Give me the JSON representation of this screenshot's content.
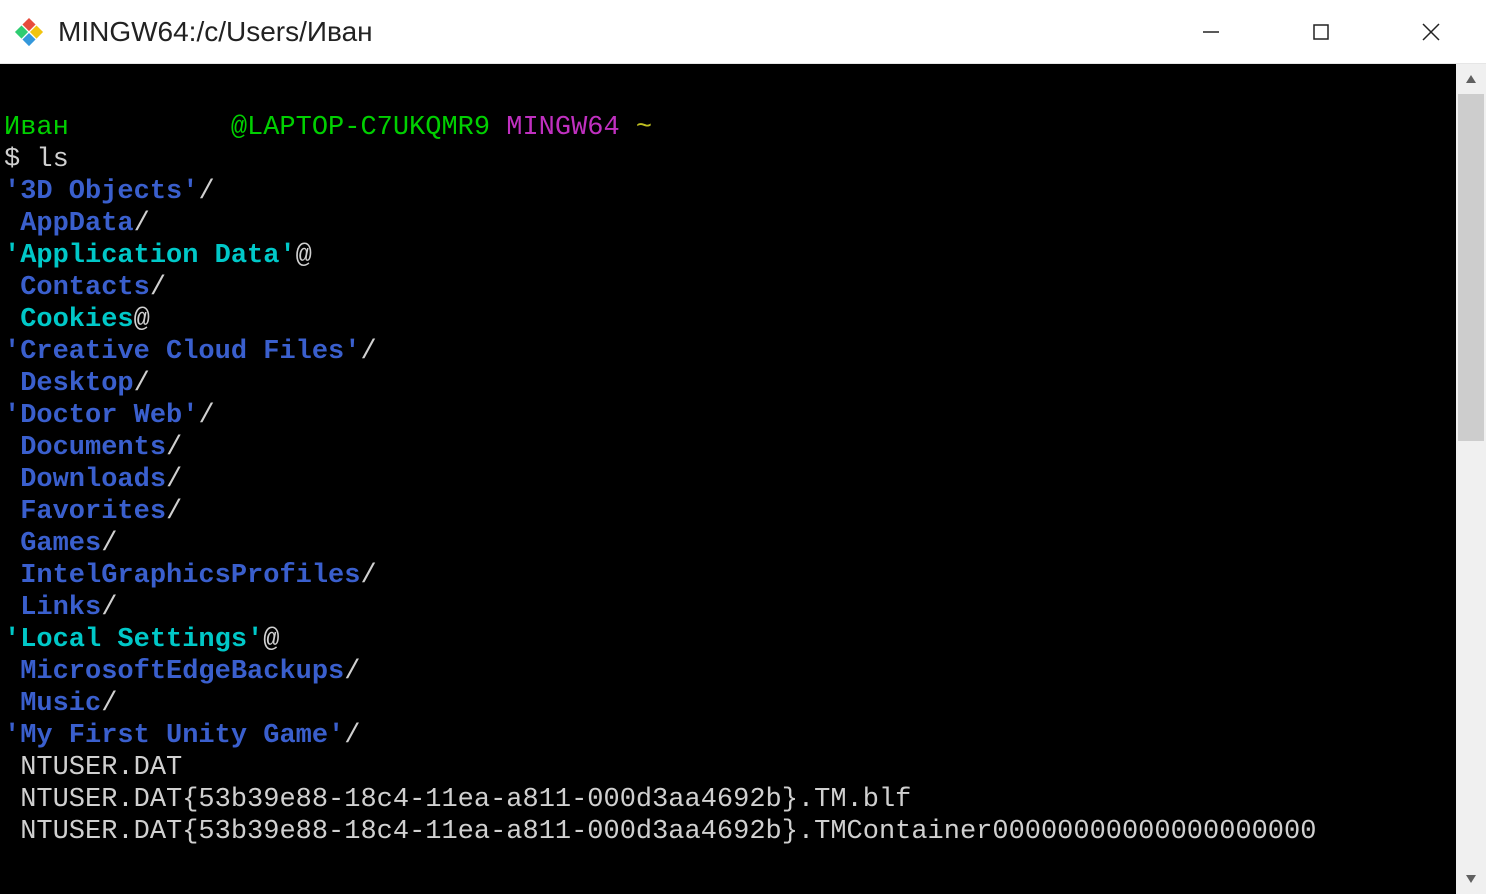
{
  "window": {
    "title": "MINGW64:/c/Users/Иван"
  },
  "prompt": {
    "user": "Иван",
    "host": "@LAPTOP-C7UKQMR9",
    "shell": "MINGW64",
    "cwd": "~",
    "symbol": "$",
    "command": "ls"
  },
  "listing": [
    {
      "name": "'3D Objects'",
      "kind": "dir",
      "suffix": "/",
      "color": "blue",
      "indent": 0
    },
    {
      "name": "AppData",
      "kind": "dir",
      "suffix": "/",
      "color": "blue",
      "indent": 1
    },
    {
      "name": "'Application Data'",
      "kind": "link",
      "suffix": "@",
      "color": "cyan",
      "indent": 0
    },
    {
      "name": "Contacts",
      "kind": "dir",
      "suffix": "/",
      "color": "blue",
      "indent": 1
    },
    {
      "name": "Cookies",
      "kind": "link",
      "suffix": "@",
      "color": "cyan",
      "indent": 1
    },
    {
      "name": "'Creative Cloud Files'",
      "kind": "dir",
      "suffix": "/",
      "color": "blue",
      "indent": 0
    },
    {
      "name": "Desktop",
      "kind": "dir",
      "suffix": "/",
      "color": "blue",
      "indent": 1
    },
    {
      "name": "'Doctor Web'",
      "kind": "dir",
      "suffix": "/",
      "color": "blue",
      "indent": 0
    },
    {
      "name": "Documents",
      "kind": "dir",
      "suffix": "/",
      "color": "blue",
      "indent": 1
    },
    {
      "name": "Downloads",
      "kind": "dir",
      "suffix": "/",
      "color": "blue",
      "indent": 1
    },
    {
      "name": "Favorites",
      "kind": "dir",
      "suffix": "/",
      "color": "blue",
      "indent": 1
    },
    {
      "name": "Games",
      "kind": "dir",
      "suffix": "/",
      "color": "blue",
      "indent": 1
    },
    {
      "name": "IntelGraphicsProfiles",
      "kind": "dir",
      "suffix": "/",
      "color": "blue",
      "indent": 1
    },
    {
      "name": "Links",
      "kind": "dir",
      "suffix": "/",
      "color": "blue",
      "indent": 1
    },
    {
      "name": "'Local Settings'",
      "kind": "link",
      "suffix": "@",
      "color": "cyan",
      "indent": 0
    },
    {
      "name": "MicrosoftEdgeBackups",
      "kind": "dir",
      "suffix": "/",
      "color": "blue",
      "indent": 1
    },
    {
      "name": "Music",
      "kind": "dir",
      "suffix": "/",
      "color": "blue",
      "indent": 1
    },
    {
      "name": "'My First Unity Game'",
      "kind": "dir",
      "suffix": "/",
      "color": "blue",
      "indent": 0
    },
    {
      "name": "NTUSER.DAT",
      "kind": "file",
      "suffix": "",
      "color": "white",
      "indent": 1
    },
    {
      "name": "NTUSER.DAT{53b39e88-18c4-11ea-a811-000d3aa4692b}.TM.blf",
      "kind": "file",
      "suffix": "",
      "color": "white",
      "indent": 1
    },
    {
      "name": "NTUSER.DAT{53b39e88-18c4-11ea-a811-000d3aa4692b}.TMContainer00000000000000000000",
      "kind": "file",
      "suffix": "",
      "color": "white",
      "indent": 1
    }
  ],
  "colors": {
    "dir_blue": "#3a5fcd",
    "link_cyan": "#00c8c8",
    "file_white": "#d0d0d0",
    "prompt_green": "#00d000",
    "prompt_magenta": "#c030c0",
    "prompt_yellow": "#c0c020"
  }
}
